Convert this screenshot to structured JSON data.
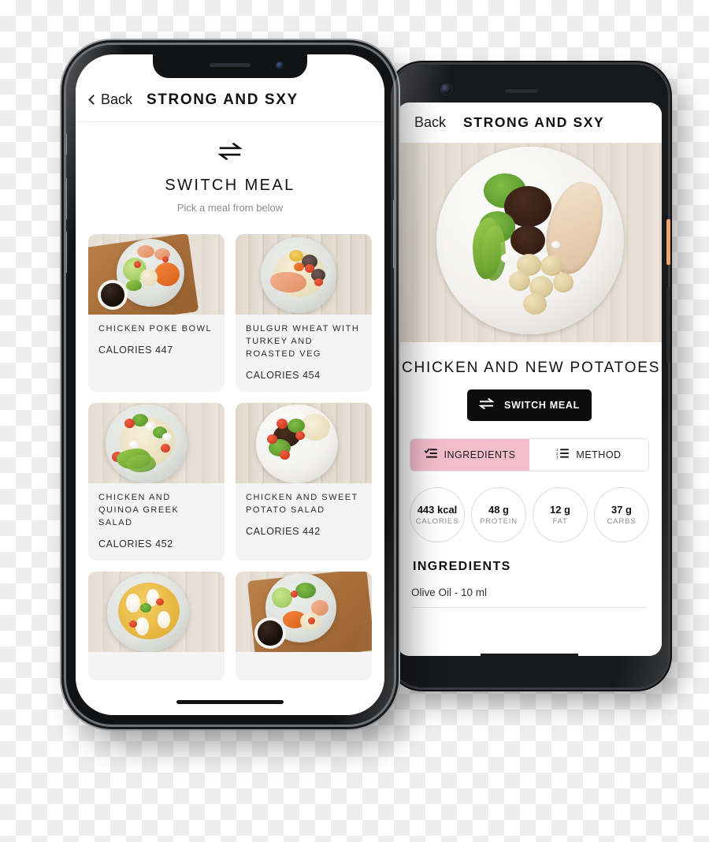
{
  "app": {
    "title": "STRONG AND SXY",
    "back_label": "Back",
    "back_icon": "chevron-left-icon"
  },
  "left_phone": {
    "device": "iphone-x",
    "switch_screen": {
      "swap_icon": "swap-arrows-icon",
      "heading": "SWITCH MEAL",
      "subheading": "Pick a meal from below",
      "meals": [
        {
          "name": "CHICKEN POKE BOWL",
          "calories_label": "CALORIES 447",
          "calories": 447,
          "image": "chicken-poke-bowl-photo"
        },
        {
          "name": "BULGUR WHEAT WITH TURKEY AND ROASTED VEG",
          "calories_label": "CALORIES 454",
          "calories": 454,
          "image": "bulgur-wheat-turkey-photo"
        },
        {
          "name": "CHICKEN AND QUINOA GREEK SALAD",
          "calories_label": "CALORIES 452",
          "calories": 452,
          "image": "chicken-quinoa-greek-salad-photo"
        },
        {
          "name": "CHICKEN AND SWEET POTATO SALAD",
          "calories_label": "CALORIES 442",
          "calories": 442,
          "image": "chicken-sweet-potato-salad-photo"
        },
        {
          "name": "",
          "calories_label": "",
          "calories": null,
          "image": "paella-rice-photo"
        },
        {
          "name": "",
          "calories_label": "",
          "calories": null,
          "image": "chicken-poke-board-photo"
        }
      ]
    }
  },
  "right_phone": {
    "device": "android-pixel",
    "detail_screen": {
      "hero_image": "chicken-and-new-potatoes-photo",
      "meal_title": "CHICKEN AND NEW POTATOES",
      "switch_button": {
        "label": "SWITCH MEAL",
        "icon": "swap-arrows-icon"
      },
      "tabs": [
        {
          "label": "INGREDIENTS",
          "icon": "checklist-icon",
          "active": true
        },
        {
          "label": "METHOD",
          "icon": "numbered-list-icon",
          "active": false
        }
      ],
      "nutrition": [
        {
          "value": "443 kcal",
          "label": "CALORIES"
        },
        {
          "value": "48 g",
          "label": "PROTEIN"
        },
        {
          "value": "12 g",
          "label": "FAT"
        },
        {
          "value": "37 g",
          "label": "CARBS"
        }
      ],
      "ingredients_heading": "INGREDIENTS",
      "ingredients": [
        {
          "text": "Olive Oil - 10 ml"
        }
      ]
    }
  },
  "colors": {
    "accent_pink": "#f3bdcd",
    "button_black": "#0c0c0c",
    "card_grey": "#f4f4f4",
    "muted_text": "#8d8d8d",
    "power_button_orange": "#e8a56d"
  }
}
